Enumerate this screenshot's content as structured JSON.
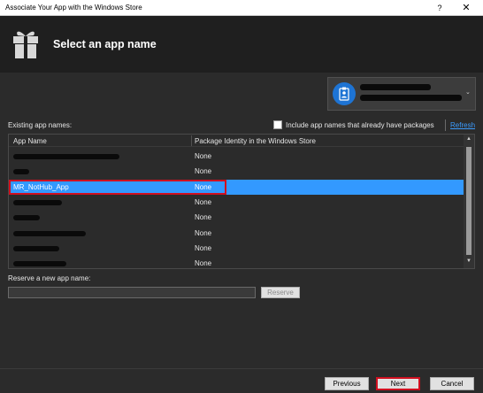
{
  "window": {
    "title": "Associate Your App with the Windows Store",
    "help_label": "?",
    "close_label": "✕"
  },
  "header": {
    "heading": "Select an app name",
    "icon": "gift-icon"
  },
  "account": {
    "icon": "person-badge-icon",
    "caret": "⌄"
  },
  "existing": {
    "label": "Existing app names:",
    "include_label": "Include app names that already have packages",
    "include_checked": false,
    "refresh_label": "Refresh"
  },
  "table": {
    "columns": [
      "App Name",
      "Package Identity in the Windows Store"
    ],
    "rows": [
      {
        "name": "",
        "identity": "None"
      },
      {
        "name": "",
        "identity": "None"
      },
      {
        "name": "MR_NotHub_App",
        "identity": "None",
        "selected": true
      },
      {
        "name": "",
        "identity": "None"
      },
      {
        "name": "",
        "identity": "None"
      },
      {
        "name": "",
        "identity": "None"
      },
      {
        "name": "",
        "identity": "None"
      },
      {
        "name": "",
        "identity": "None"
      }
    ]
  },
  "reserve": {
    "label": "Reserve a new app name:",
    "value": "",
    "button_label": "Reserve"
  },
  "footer": {
    "previous_label": "Previous",
    "next_label": "Next",
    "cancel_label": "Cancel"
  },
  "colors": {
    "selection": "#3399ff",
    "highlight": "#d01020",
    "link": "#3b9cff",
    "header_bg": "#1f1f1f",
    "body_bg": "#2b2b2b"
  }
}
